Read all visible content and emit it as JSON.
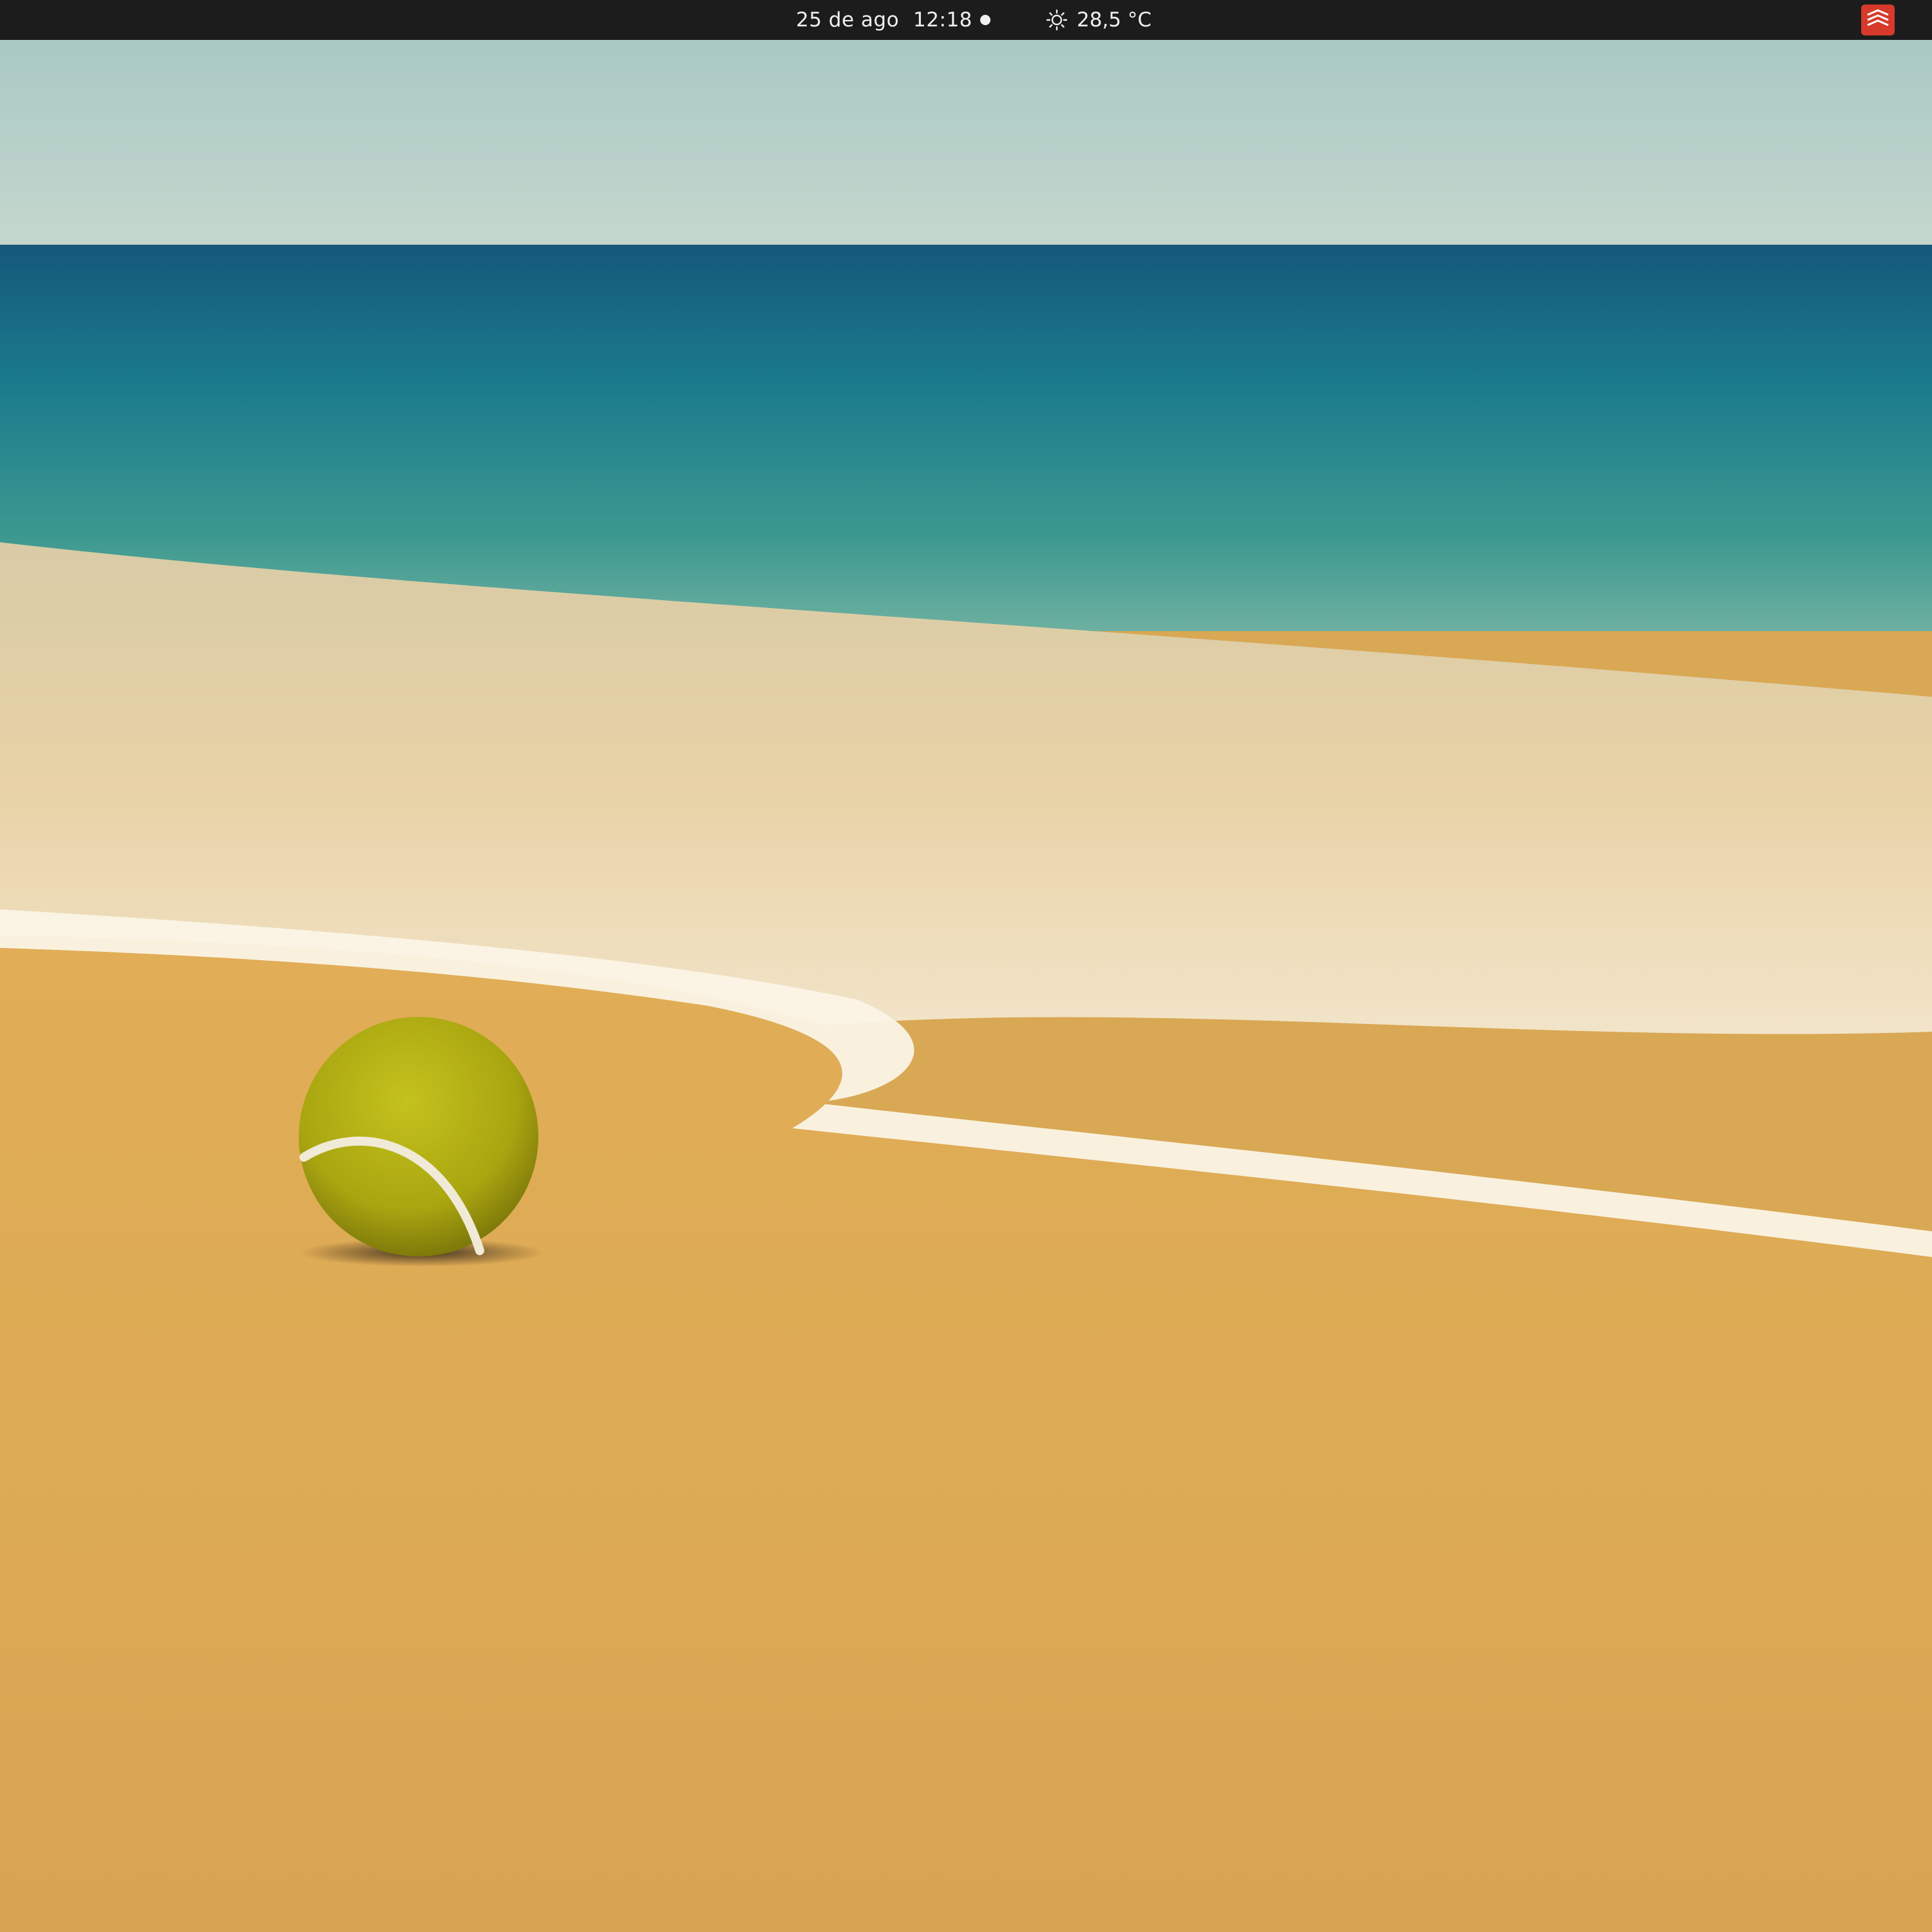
{
  "top_bar": {
    "date": "25 de ago",
    "time": "12:18",
    "weather_icon": "weather-sunny-icon",
    "temperature": "28,5 °C",
    "tray_icon": "todoist-icon"
  },
  "colors": {
    "top_bar": "#1c1c1c",
    "sky": "#b9d4cf",
    "sea": "#1f7f8e",
    "sand": "#dca857",
    "foam": "#fbf4e6",
    "ball": "#b8b314",
    "tray_icon": "#d63a2a"
  }
}
